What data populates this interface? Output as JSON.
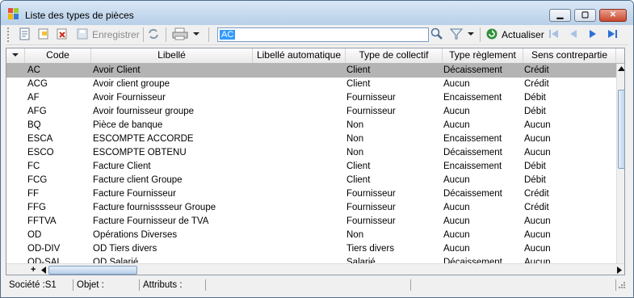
{
  "window": {
    "title": "Liste des types de pièces",
    "controls": {
      "minimize": "▁",
      "maximize": "▢",
      "close": "✕"
    }
  },
  "toolbar": {
    "save_label": "Enregistrer",
    "search_value": "AC",
    "refresh_label": "Actualiser"
  },
  "table": {
    "columns": [
      "Code",
      "Libellé",
      "Libellé automatique",
      "Type de collectif",
      "Type règlement",
      "Sens contrepartie"
    ],
    "rows": [
      {
        "code": "AC",
        "libelle": "Avoir Client",
        "auto": "",
        "collectif": "Client",
        "reglement": "Décaissement",
        "sens": "Crédit"
      },
      {
        "code": "ACG",
        "libelle": "Avoir client  groupe",
        "auto": "",
        "collectif": "Client",
        "reglement": "Aucun",
        "sens": "Crédit"
      },
      {
        "code": "AF",
        "libelle": "Avoir Fournisseur",
        "auto": "",
        "collectif": "Fournisseur",
        "reglement": "Encaissement",
        "sens": "Débit"
      },
      {
        "code": "AFG",
        "libelle": "Avoir  fournisseur groupe",
        "auto": "",
        "collectif": "Fournisseur",
        "reglement": "Aucun",
        "sens": "Débit"
      },
      {
        "code": "BQ",
        "libelle": "Pièce de banque",
        "auto": "",
        "collectif": "Non",
        "reglement": "Aucun",
        "sens": "Aucun"
      },
      {
        "code": "ESCA",
        "libelle": "ESCOMPTE ACCORDE",
        "auto": "",
        "collectif": "Non",
        "reglement": "Encaissement",
        "sens": "Aucun"
      },
      {
        "code": "ESCO",
        "libelle": "ESCOMPTE OBTENU",
        "auto": "",
        "collectif": "Non",
        "reglement": "Décaissement",
        "sens": "Aucun"
      },
      {
        "code": "FC",
        "libelle": "Facture Client",
        "auto": "",
        "collectif": "Client",
        "reglement": "Encaissement",
        "sens": "Débit"
      },
      {
        "code": "FCG",
        "libelle": "Facture client  Groupe",
        "auto": "",
        "collectif": "Client",
        "reglement": "Aucun",
        "sens": "Débit"
      },
      {
        "code": "FF",
        "libelle": "Facture Fournisseur",
        "auto": "",
        "collectif": "Fournisseur",
        "reglement": "Décaissement",
        "sens": "Crédit"
      },
      {
        "code": "FFG",
        "libelle": "Facture  fournisssseur Groupe",
        "auto": "",
        "collectif": "Fournisseur",
        "reglement": "Aucun",
        "sens": "Crédit"
      },
      {
        "code": "FFTVA",
        "libelle": "Facture Fournisseur de TVA",
        "auto": "",
        "collectif": "Fournisseur",
        "reglement": "Aucun",
        "sens": "Aucun"
      },
      {
        "code": "OD",
        "libelle": "Opérations Diverses",
        "auto": "",
        "collectif": "Non",
        "reglement": "Aucun",
        "sens": "Aucun"
      },
      {
        "code": "OD-DIV",
        "libelle": "OD Tiers divers",
        "auto": "",
        "collectif": "Tiers divers",
        "reglement": "Aucun",
        "sens": "Aucun"
      },
      {
        "code": "OD-SAL",
        "libelle": "OD Salarié",
        "auto": "",
        "collectif": "Salarié",
        "reglement": "Décaissement",
        "sens": "Aucun"
      }
    ]
  },
  "status": {
    "societe": "Société :S1",
    "objet": "Objet :",
    "attributs": "Attributs :"
  },
  "colors": {
    "selected_row": "#b4b4b4",
    "nav_blue": "#2b6fd6"
  }
}
